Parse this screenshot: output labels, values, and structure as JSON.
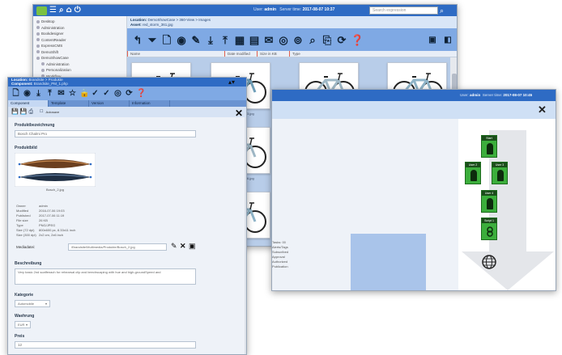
{
  "w1": {
    "app_icons": [
      "arrow-logo-icon",
      "menu-icon",
      "search-icon",
      "home-icon",
      "power-icon"
    ],
    "user_label": "User:",
    "user_name": "admin",
    "server_label": "Server time:",
    "server_time": "2017-08-07 10:37",
    "search_placeholder": "Search expression",
    "location_label": "Location:",
    "location_value": "DemoShowCase > 360-View > Images",
    "asset_label": "Asset:",
    "asset_value": "red_storm_361.jpg",
    "tree": [
      "Desktop",
      "Administration",
      "Bookdesigner",
      "ContentReader",
      "ExpressCMS",
      "DemoShift",
      "DemoShowCase",
      "Administration",
      "Personalization",
      "Workflow"
    ],
    "columns": [
      "Name",
      "Date modified",
      "Size in KB",
      "Type"
    ],
    "captions": [
      "red_storm_001.jpg",
      "red_storm_003.jpg",
      "red_storm_004.jpg",
      "red_storm_005.jpg",
      "red_storm_006.jpg",
      "red_storm_007.jpg",
      "red_storm_008.jpg"
    ]
  },
  "w2": {
    "location_label": "Location:",
    "location_value": "Brandsite > Produkte",
    "component_label": "Component:",
    "component_value": "Brandsite_PM_1.php",
    "tabs": [
      "Component",
      "Template",
      "Version",
      "Information"
    ],
    "autosave_label": "Autosave",
    "fields": {
      "produktbezeichnung_label": "Produktbezeichnung",
      "produktbezeichnung_value": "Bosch Chalmi Pro",
      "produktbild_label": "Produktbild",
      "image_caption": "Bosch_2.jpg",
      "meta": [
        {
          "k": "Owner",
          "v": "admin"
        },
        {
          "k": "Modified",
          "v": "2016-07-06 19:03"
        },
        {
          "k": "Published",
          "v": "2017-07-06 11:19"
        },
        {
          "k": "File size",
          "v": "26 KB"
        },
        {
          "k": "Type",
          "v": "PNG/JPEG"
        },
        {
          "k": "Size (72 dpi)",
          "v": "800x600 px, 8.33x11 inch"
        },
        {
          "k": "Size (300 dpi)",
          "v": "2x2 cm, 2x6 inch"
        }
      ],
      "media_label": "Mediadatei:",
      "media_path": "/Brandsite/Multimedia/Produkte/Bosch_2.jpg",
      "beschreibung_label": "Beschreibung",
      "beschreibung_value": "Very basic 2nd scaffenach for rehearsal clip and beechscaping with hue and high-groundSpeed and",
      "kategorie_label": "Kategorie",
      "kategorie_value": "Automobile",
      "waehrung_label": "Waehrung",
      "waehrung_value": "EUR",
      "preis_label": "Preis",
      "preis_value": "12"
    }
  },
  "w3": {
    "user_label": "User:",
    "user_name": "admin",
    "server_label": "Server time:",
    "server_time": "2017-08-07 10:45",
    "steps": [
      "Start",
      "User 2",
      "User 3",
      "User 4",
      "Script 1"
    ],
    "list": [
      "Tasks: 00",
      "Alerts/Tags",
      "Subscribed",
      "Approval",
      "Authorized",
      "Publication"
    ]
  }
}
